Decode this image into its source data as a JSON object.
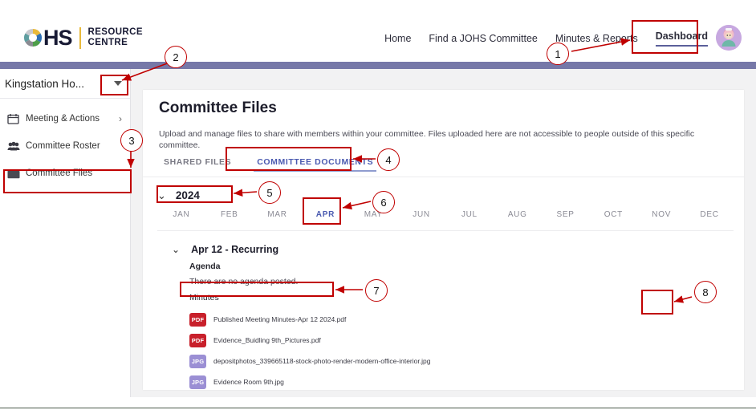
{
  "brand": {
    "logo_hs": "HS",
    "logo_line1": "RESOURCE",
    "logo_line2": "CENTRE",
    "logo_icon": "ohs-circle-logo",
    "accent_band_color": "#7678a8"
  },
  "top_nav": {
    "items": [
      {
        "label": "Home",
        "active": false
      },
      {
        "label": "Find a JOHS Committee",
        "active": false
      },
      {
        "label": "Minutes & Reports",
        "active": false
      },
      {
        "label": "Dashboard",
        "active": true
      }
    ],
    "avatar_alt": "user-avatar"
  },
  "sidebar": {
    "committee_picker": {
      "label": "Kingstation Ho...",
      "icon": "caret-down-icon"
    },
    "items": [
      {
        "label": "Meeting & Actions",
        "icon": "calendar-icon",
        "chevron": "›",
        "selected": false
      },
      {
        "label": "Committee Roster",
        "icon": "people-icon",
        "chevron": "",
        "selected": false
      },
      {
        "label": "Committee Files",
        "icon": "folder-icon",
        "chevron": "",
        "selected": true
      }
    ]
  },
  "main": {
    "title": "Committee Files",
    "description": "Upload and manage files to share with members within your committee. Files uploaded here are not accessible to people outside of this specific committee.",
    "tabs": [
      {
        "label": "SHARED FILES",
        "active": false
      },
      {
        "label": "COMMITTEE DOCUMENTS",
        "active": true
      }
    ],
    "year": {
      "label": "2024",
      "chevron": "⌄"
    },
    "months": [
      {
        "label": "JAN",
        "active": false
      },
      {
        "label": "FEB",
        "active": false
      },
      {
        "label": "MAR",
        "active": false
      },
      {
        "label": "APR",
        "active": true
      },
      {
        "label": "MAY",
        "active": false
      },
      {
        "label": "JUN",
        "active": false
      },
      {
        "label": "JUL",
        "active": false
      },
      {
        "label": "AUG",
        "active": false
      },
      {
        "label": "SEP",
        "active": false
      },
      {
        "label": "OCT",
        "active": false
      },
      {
        "label": "NOV",
        "active": false
      },
      {
        "label": "DEC",
        "active": false
      }
    ],
    "meeting": {
      "chevron": "⌄",
      "title": "Apr 12 - Recurring",
      "agenda_label": "Agenda",
      "agenda_empty": "There are no agenda posted.",
      "minutes_label": "Minutes",
      "files": [
        {
          "type": "PDF",
          "name": "Published Meeting Minutes-Apr 12 2024.pdf",
          "download_icon": "download-icon"
        },
        {
          "type": "PDF",
          "name": "Evidence_Buidling 9th_Pictures.pdf",
          "download_icon": "download-icon"
        },
        {
          "type": "JPG",
          "name": "depositphotos_339665118-stock-photo-render-modern-office-interior.jpg",
          "download_icon": "download-icon"
        },
        {
          "type": "JPG",
          "name": "Evidence Room 9th.jpg",
          "download_icon": "download-icon"
        }
      ]
    }
  },
  "annotations": {
    "color": "#c00000",
    "callouts": [
      {
        "number": "1",
        "target": "dashboard-nav-item"
      },
      {
        "number": "2",
        "target": "committee-picker-caret"
      },
      {
        "number": "3",
        "target": "sidebar-item-committee-files"
      },
      {
        "number": "4",
        "target": "tab-committee-documents"
      },
      {
        "number": "5",
        "target": "year-selector"
      },
      {
        "number": "6",
        "target": "month-apr"
      },
      {
        "number": "7",
        "target": "minutes-label"
      },
      {
        "number": "8",
        "target": "download-button-first-file"
      }
    ]
  }
}
